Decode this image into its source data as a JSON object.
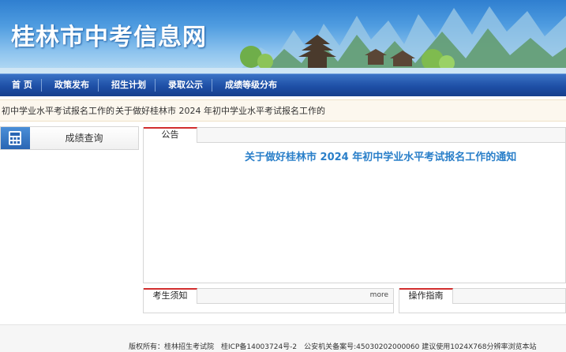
{
  "banner": {
    "title": "桂林市中考信息网"
  },
  "nav": {
    "items": [
      {
        "label": "首 页"
      },
      {
        "label": "政策发布"
      },
      {
        "label": "招生计划"
      },
      {
        "label": "录取公示"
      },
      {
        "label": "成绩等级分布"
      }
    ]
  },
  "marquee": {
    "items": [
      {
        "text": "初中学业水平考试报名工作的"
      },
      {
        "text": "关于做好桂林市 2024 年初中学业水平考试报名工作的"
      }
    ]
  },
  "sidebar": {
    "score_query_label": "成绩查询",
    "icon": "calculator-icon"
  },
  "main": {
    "tab_label": "公告",
    "headline": "关于做好桂林市 2024 年初中学业水平考试报名工作的通知"
  },
  "notice_box": {
    "tab_label": "考生须知",
    "more_label": "more"
  },
  "guide_box": {
    "tab_label": "操作指南"
  },
  "footer": {
    "copyright": "版权所有：桂林招生考试院　桂ICP备14003724号-2　公安机关备案号:45030202000060 建议使用1024X768分辨率浏览本站"
  },
  "colors": {
    "nav_blue": "#1e4fa6",
    "headline_blue": "#2a7fc9",
    "tab_accent_red": "#d22e2e",
    "marquee_bg": "#fcf7ee"
  }
}
